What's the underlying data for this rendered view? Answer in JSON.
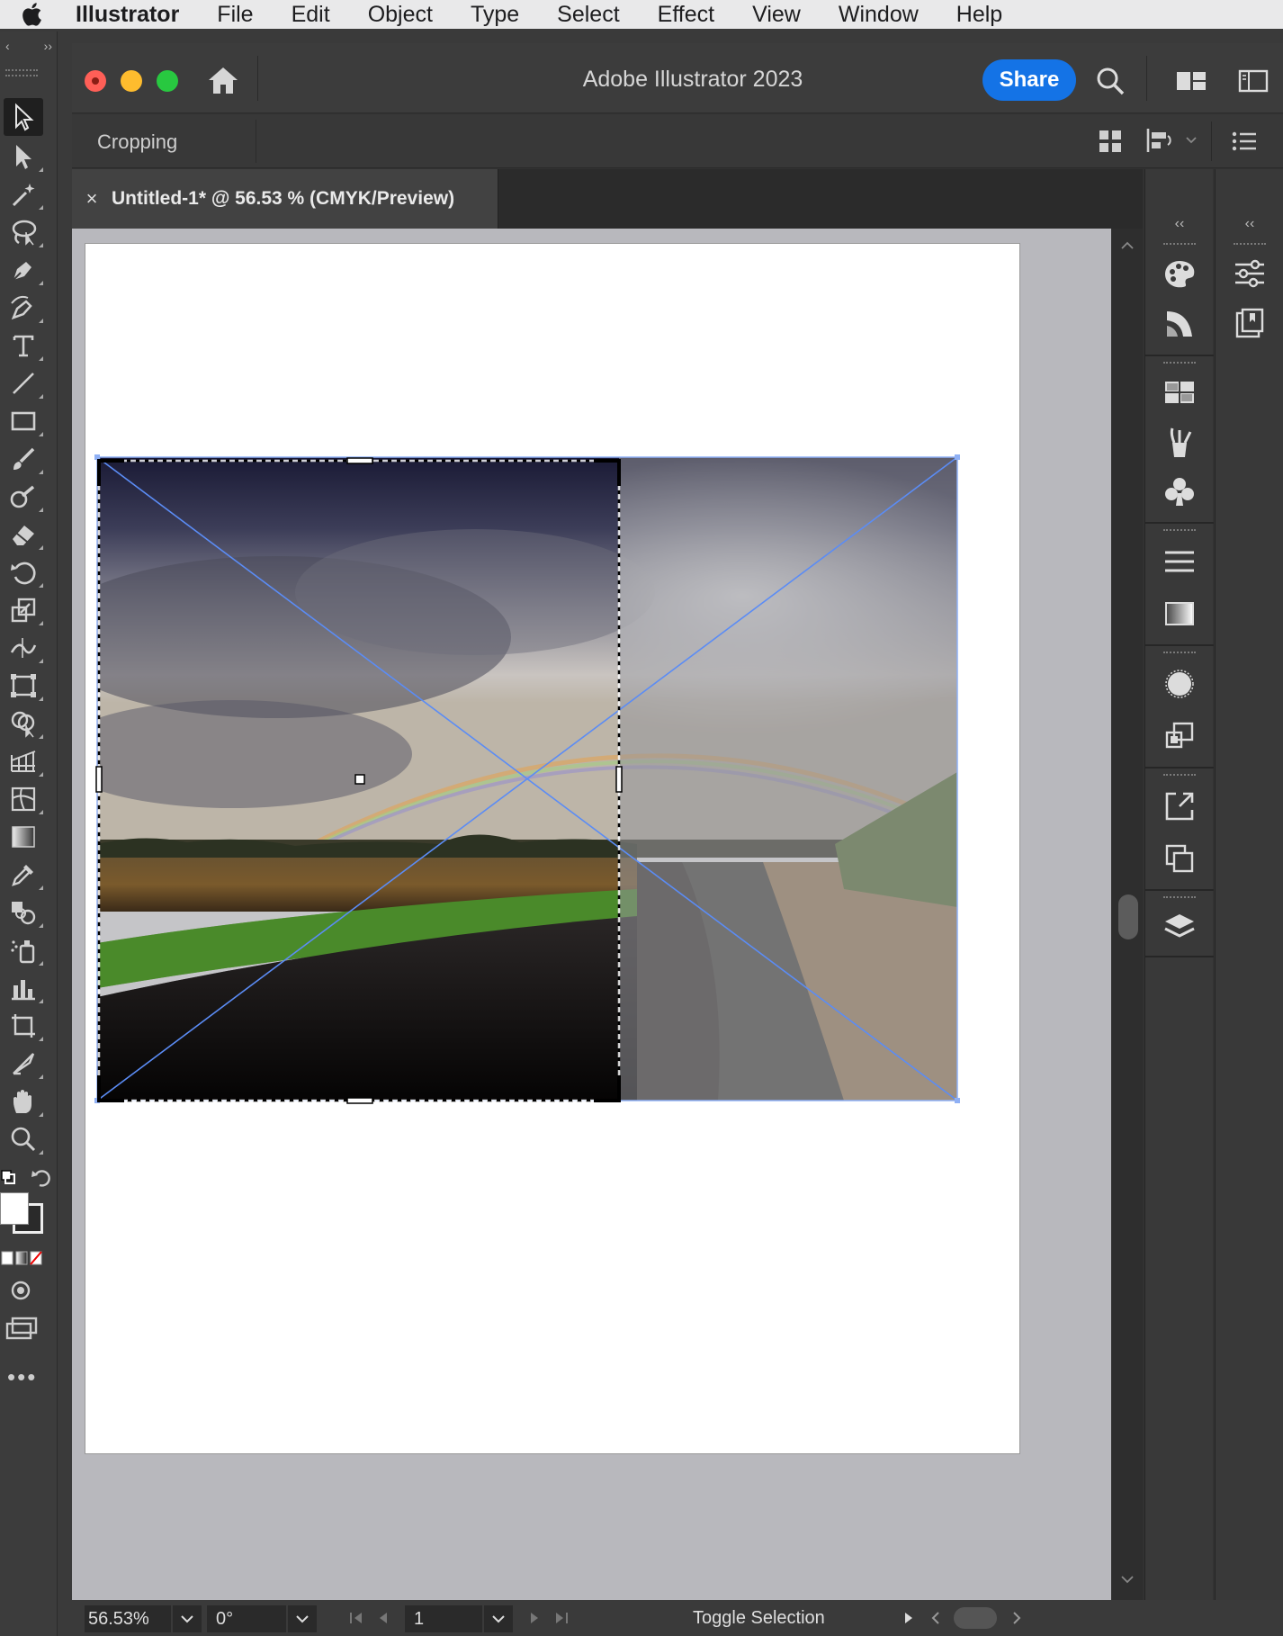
{
  "menubar": {
    "app": "Illustrator",
    "items": [
      "File",
      "Edit",
      "Object",
      "Type",
      "Select",
      "Effect",
      "View",
      "Window",
      "Help"
    ]
  },
  "window": {
    "title": "Adobe Illustrator 2023",
    "share_label": "Share"
  },
  "controlbar": {
    "label": "Cropping"
  },
  "document": {
    "tab_title": "Untitled-1* @ 56.53 % (CMYK/Preview)",
    "close_symbol": "×"
  },
  "statusbar": {
    "zoom": "56.53%",
    "rotation": "0°",
    "page": "1",
    "status": "Toggle Selection"
  },
  "colors": {
    "accent": "#1473e6",
    "selection_blue": "#5b8cf5",
    "chrome_dark": "#323232"
  },
  "icons": {
    "left_toolbar": [
      "selection-tool",
      "direct-selection-tool",
      "magic-wand-tool",
      "lasso-tool",
      "pen-tool",
      "curvature-tool",
      "type-tool",
      "line-segment-tool",
      "rectangle-tool",
      "paintbrush-tool",
      "shaper-tool",
      "eraser-tool",
      "rotate-tool",
      "scale-tool",
      "width-tool",
      "free-transform-tool",
      "shape-builder-tool",
      "perspective-grid-tool",
      "mesh-tool",
      "gradient-tool",
      "eyedropper-tool",
      "blend-tool",
      "symbol-sprayer-tool",
      "column-graph-tool",
      "artboard-tool",
      "slice-tool",
      "hand-tool",
      "zoom-tool"
    ],
    "dock": [
      "color-icon",
      "color-guide-icon",
      "swatches-icon",
      "brushes-icon",
      "symbols-icon",
      "stroke-icon",
      "gradient-icon",
      "transparency-icon",
      "appearance-icon",
      "export-icon",
      "artboards-icon",
      "layers-icon",
      "properties-icon",
      "libraries-icon"
    ]
  }
}
